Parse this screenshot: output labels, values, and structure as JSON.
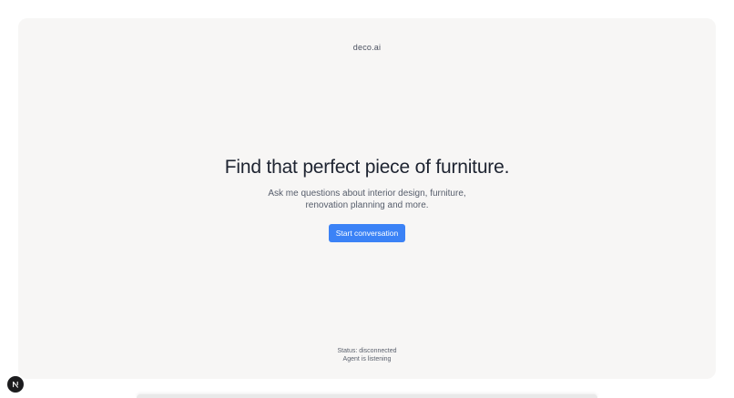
{
  "header": {
    "brand": "deco.ai"
  },
  "hero": {
    "headline": "Find that perfect piece of furniture.",
    "subtitle": "Ask me questions about interior design, furniture, renovation planning and more.",
    "cta_label": "Start conversation"
  },
  "status": {
    "connection": "Status: disconnected",
    "agent": "Agent is listening"
  },
  "badge": {
    "icon": "nextjs-icon"
  },
  "colors": {
    "accent": "#3b82f6",
    "card_background": "#f7f6f5",
    "headline": "#1e2431"
  }
}
